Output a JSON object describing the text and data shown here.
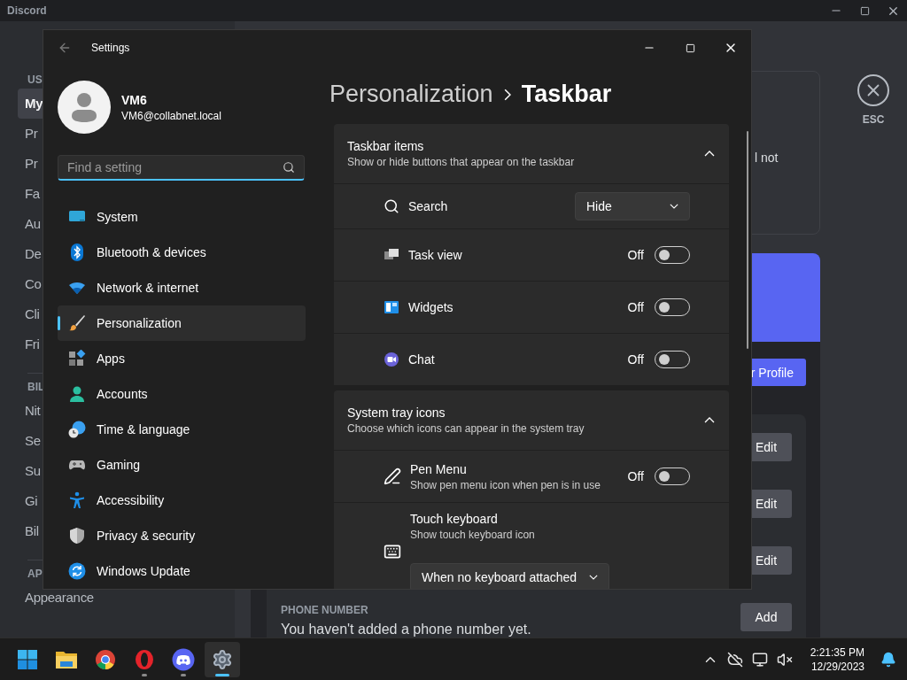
{
  "discord": {
    "title": "Discord",
    "sidebar": [
      {
        "kind": "header",
        "label": "US"
      },
      {
        "kind": "item",
        "label": "My",
        "selected": true
      },
      {
        "kind": "item",
        "label": "Pr",
        "selected": false
      },
      {
        "kind": "item",
        "label": "Pr",
        "selected": false
      },
      {
        "kind": "item",
        "label": "Fa",
        "selected": false
      },
      {
        "kind": "item",
        "label": "Au",
        "selected": false
      },
      {
        "kind": "item",
        "label": "De",
        "selected": false
      },
      {
        "kind": "item",
        "label": "Co",
        "selected": false
      },
      {
        "kind": "item",
        "label": "Cli",
        "selected": false
      },
      {
        "kind": "item",
        "label": "Fri",
        "selected": false
      },
      {
        "kind": "header",
        "label": "BIL"
      },
      {
        "kind": "item",
        "label": "Nit",
        "selected": false
      },
      {
        "kind": "item",
        "label": "Se",
        "selected": false
      },
      {
        "kind": "item",
        "label": "Su",
        "selected": false
      },
      {
        "kind": "item",
        "label": "Gi",
        "selected": false
      },
      {
        "kind": "item",
        "label": "Bil",
        "selected": false
      },
      {
        "kind": "header",
        "label": "AP"
      },
      {
        "kind": "item",
        "label": "Appearance",
        "selected": false
      }
    ],
    "notice_fragment": "l not",
    "profile_button": "r Profile",
    "edit_buttons": [
      "Edit",
      "Edit",
      "Edit"
    ],
    "phone": {
      "label": "PHONE NUMBER",
      "text": "You haven't added a phone number yet.",
      "button": "Add"
    },
    "close_label": "ESC"
  },
  "settings": {
    "title": "Settings",
    "user": {
      "name": "VM6",
      "email": "VM6@collabnet.local"
    },
    "search": {
      "placeholder": "Find a setting"
    },
    "nav": [
      {
        "label": "System",
        "selected": false
      },
      {
        "label": "Bluetooth & devices",
        "selected": false
      },
      {
        "label": "Network & internet",
        "selected": false
      },
      {
        "label": "Personalization",
        "selected": true
      },
      {
        "label": "Apps",
        "selected": false
      },
      {
        "label": "Accounts",
        "selected": false
      },
      {
        "label": "Time & language",
        "selected": false
      },
      {
        "label": "Gaming",
        "selected": false
      },
      {
        "label": "Accessibility",
        "selected": false
      },
      {
        "label": "Privacy & security",
        "selected": false
      },
      {
        "label": "Windows Update",
        "selected": false
      }
    ],
    "breadcrumb": {
      "parent": "Personalization",
      "current": "Taskbar"
    },
    "sections": [
      {
        "title": "Taskbar items",
        "subtitle": "Show or hide buttons that appear on the taskbar",
        "expanded": true,
        "rows": [
          {
            "kind": "dropdown",
            "label": "Search",
            "value": "Hide"
          },
          {
            "kind": "toggle",
            "label": "Task view",
            "status": "Off",
            "on": false
          },
          {
            "kind": "toggle",
            "label": "Widgets",
            "status": "Off",
            "on": false
          },
          {
            "kind": "toggle",
            "label": "Chat",
            "status": "Off",
            "on": false
          }
        ]
      },
      {
        "title": "System tray icons",
        "subtitle": "Choose which icons can appear in the system tray",
        "expanded": true,
        "rows": [
          {
            "kind": "toggle",
            "label": "Pen Menu",
            "subtitle": "Show pen menu icon when pen is in use",
            "status": "Off",
            "on": false
          },
          {
            "kind": "dropdown-below",
            "label": "Touch keyboard",
            "subtitle": "Show touch keyboard icon",
            "value": "When no keyboard attached"
          }
        ]
      }
    ]
  },
  "taskbar": {
    "apps": [
      {
        "running": false,
        "selected": false
      },
      {
        "running": false,
        "selected": false
      },
      {
        "running": false,
        "selected": false
      },
      {
        "running": true,
        "selected": false
      },
      {
        "running": true,
        "selected": false
      },
      {
        "running": true,
        "selected": true
      }
    ],
    "time": "2:21:35 PM",
    "date": "12/29/2023"
  }
}
